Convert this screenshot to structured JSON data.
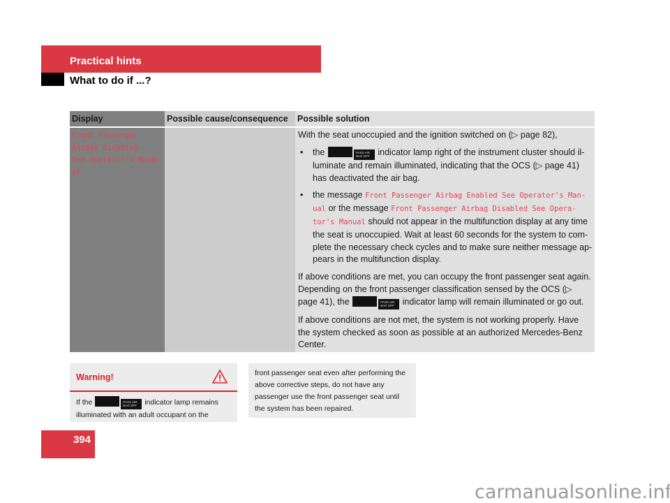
{
  "header": {
    "section": "Practical hints",
    "subsection": "What to do if ...?"
  },
  "table": {
    "columns": [
      "Display",
      "Possible cause/consequence",
      "Possible solution"
    ],
    "row": {
      "display_lines": [
        "Front Passenger",
        "Airbag Disabled",
        "See Operator's Manu-",
        "al"
      ],
      "cause": "",
      "solution": {
        "intro": "With the seat unoccupied and the ignition switched on (▷ page 82),",
        "bullet1_pre": "the",
        "bullet1_post": "indicator lamp right of the instrument cluster should il-luminate and remain illuminated, indicating that the OCS (▷ page 41) has deactivated the air bag.",
        "bullet2_pre": "the message",
        "bullet2_msg1": "Front Passenger Airbag Enabled See Operator's Man-ual",
        "bullet2_mid": "or the message",
        "bullet2_msg2": "Front Passenger Airbag Disabled See Opera-tor's Manual",
        "bullet2_post": "should not appear in the multifunction display at any time the seat is unoccupied. Wait at least 60 seconds for the system to com-plete the necessary check cycles and to make sure neither message ap-pears in the multifunction display.",
        "para2_pre": "If above conditions are met, you can occupy the front passenger seat again. Depending on the front passenger classification sensed by the OCS (▷ page 41), the",
        "para2_post": "indicator lamp will remain illuminated or go out.",
        "para3": "If above conditions are not met, the system is not working properly. Have the system checked as soon as possible at an authorized Mercedes-Benz Center."
      }
    }
  },
  "lamp": {
    "icon1": "airbag-occupant-icon",
    "icon2_text": "PASS AIR BAG OFF"
  },
  "warning": {
    "title": "Warning!",
    "icon": "warning-triangle-icon",
    "body_pre": "If the",
    "body_post": "indicator lamp remains illuminated with an adult occupant on the",
    "continued": "front passenger seat even after performing the above corrective steps, do not have any passenger use the front passenger seat until the system has been repaired."
  },
  "page_number": "394",
  "watermark": "carmanualsonline.info"
}
